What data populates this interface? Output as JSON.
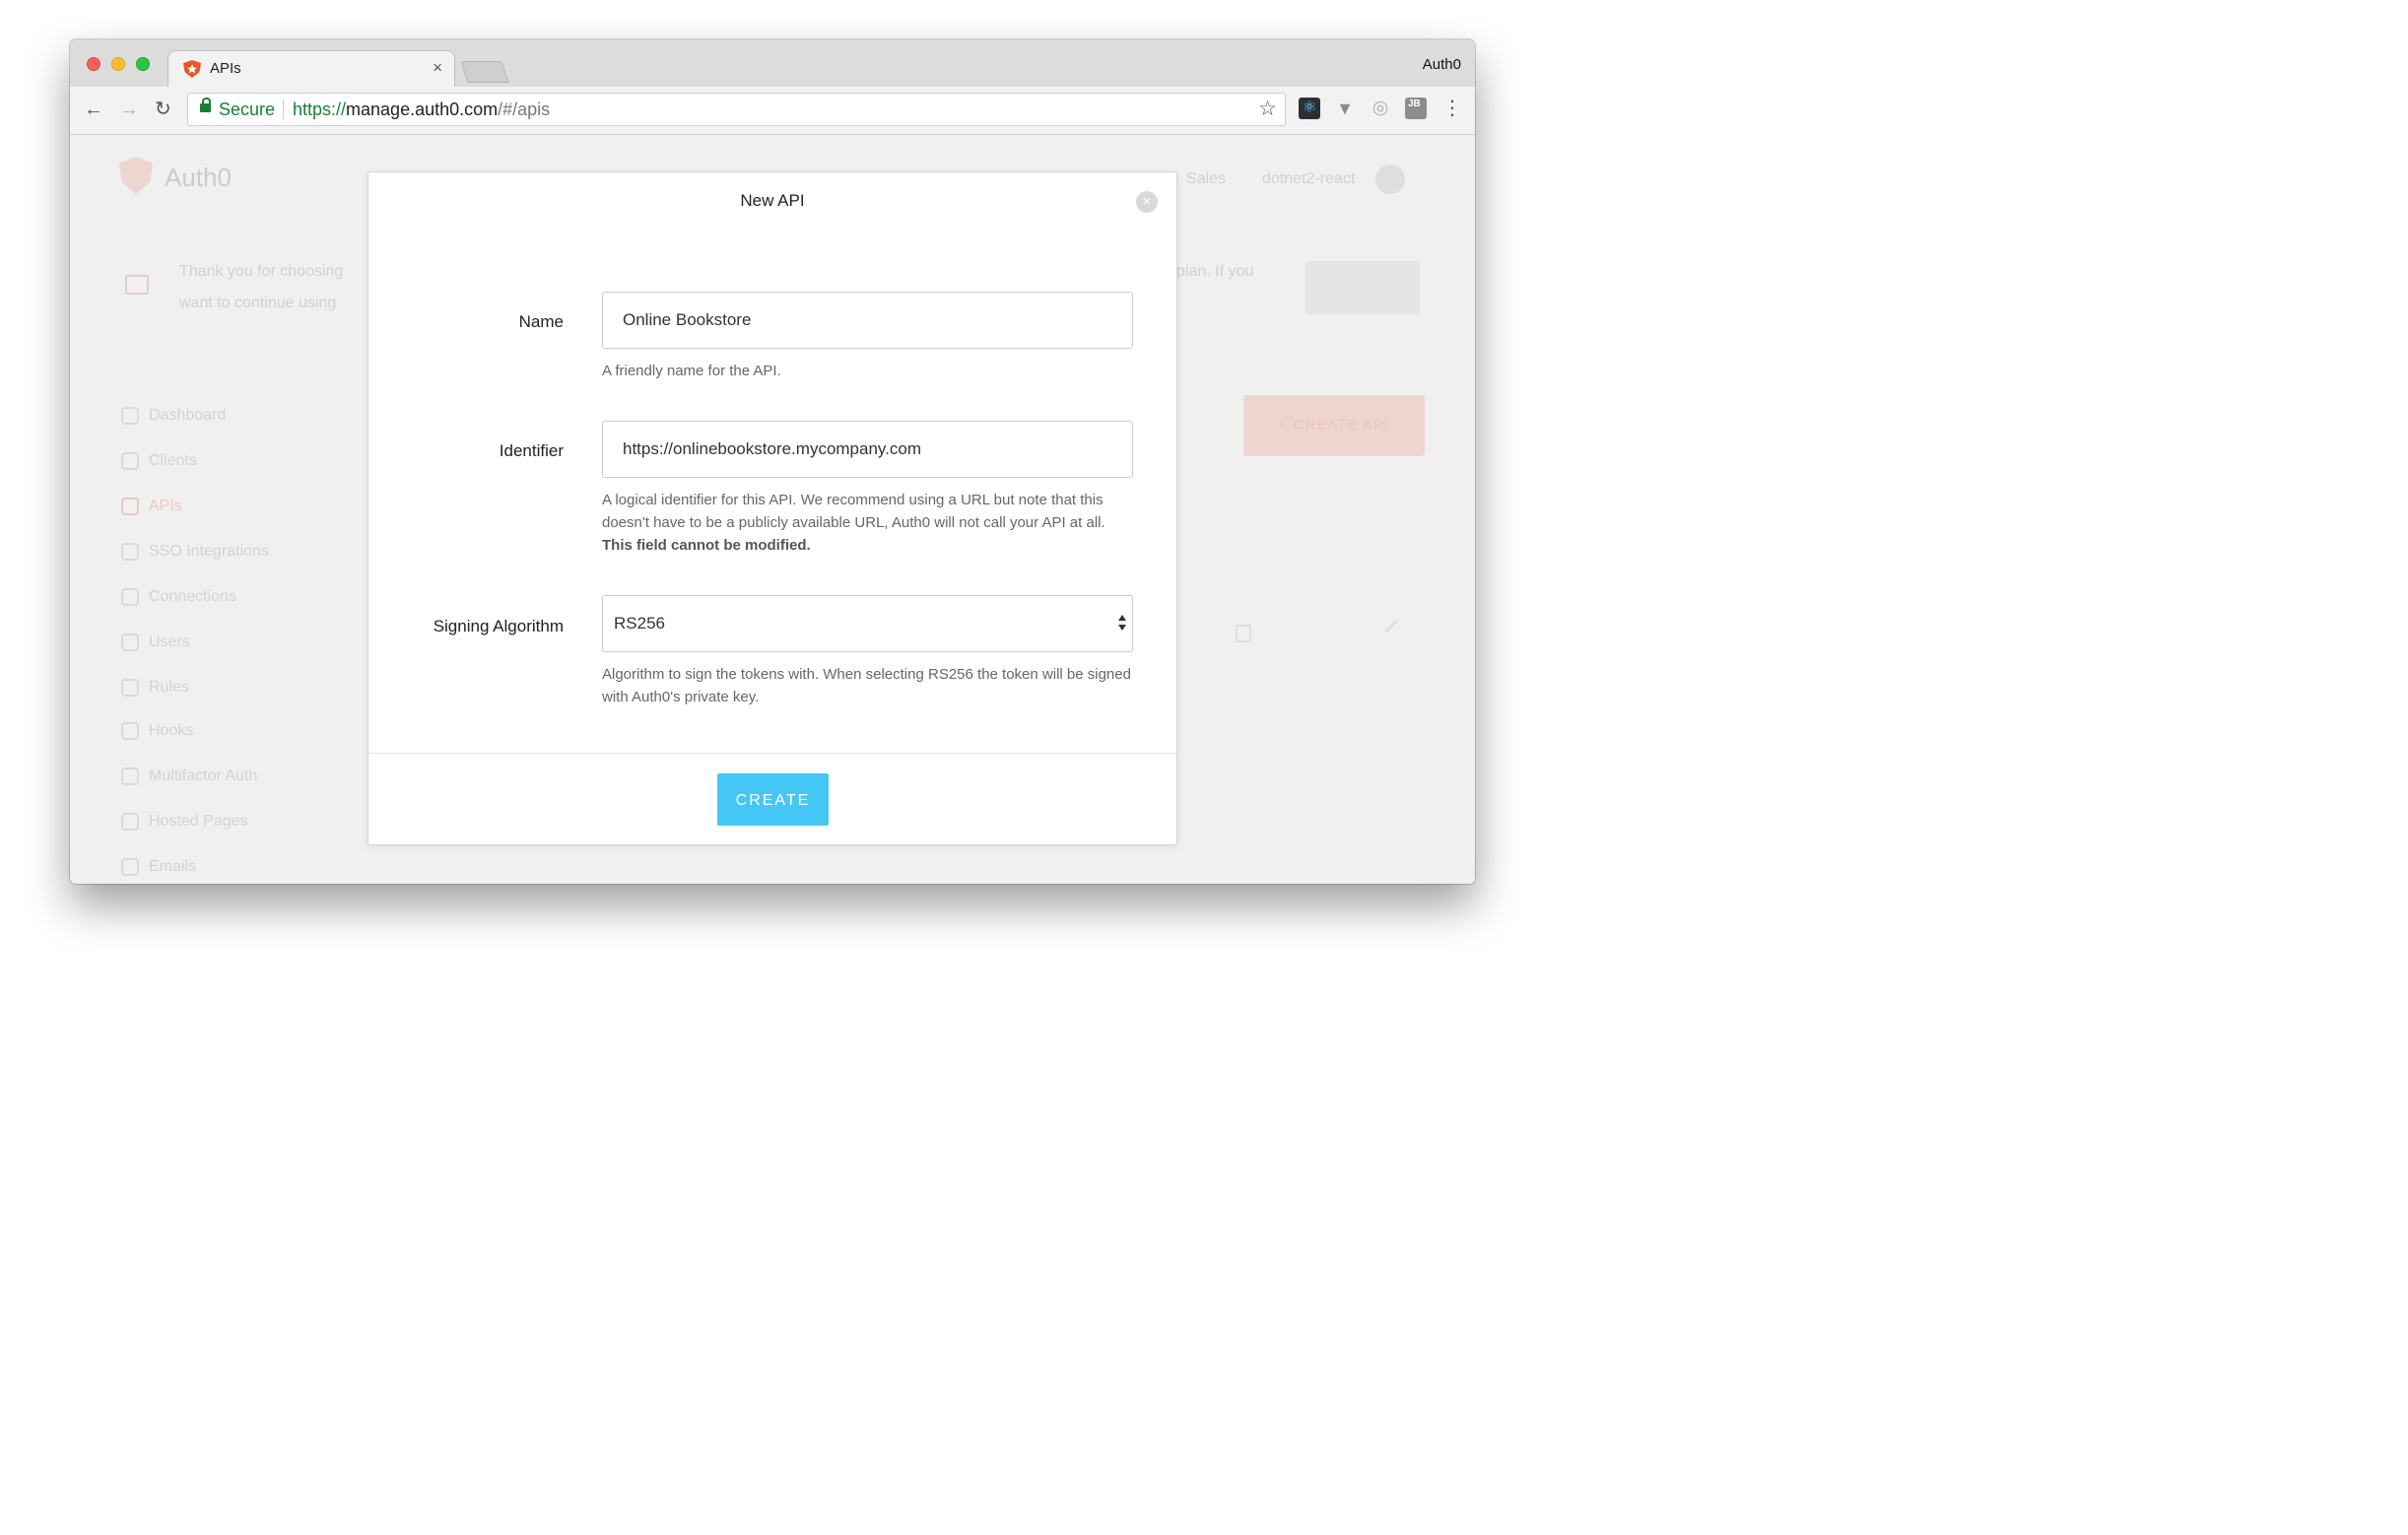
{
  "browser": {
    "tab_title": "APIs",
    "tab_close": "×",
    "profile_name": "Auth0",
    "secure_label": "Secure",
    "url_scheme": "https://",
    "url_host": "manage.auth0.com",
    "url_path": "/#/apis",
    "back_glyph": "←",
    "forward_glyph": "→",
    "reload_glyph": "↻",
    "star_glyph": "☆",
    "menu_glyph": "⋮",
    "extensions": {
      "react_glyph": "⚛",
      "vue_glyph": "▼",
      "gear_glyph": "◎",
      "jb_label": "JB"
    }
  },
  "background": {
    "logo_text": "Auth0",
    "header_link": "Sales",
    "tenant_name": "dotnet2-react",
    "notice_line1": "Thank you for choosing",
    "notice_line1_tail": "plan. If you",
    "notice_line2": "want to continue using",
    "create_api_label": "+ CREATE API",
    "sidebar": [
      {
        "label": "Dashboard",
        "active": false
      },
      {
        "label": "Clients",
        "active": false
      },
      {
        "label": "APIs",
        "active": true
      },
      {
        "label": "SSO Integrations",
        "active": false
      },
      {
        "label": "Connections",
        "active": false
      },
      {
        "label": "Users",
        "active": false
      },
      {
        "label": "Rules",
        "active": false
      },
      {
        "label": "Hooks",
        "active": false
      },
      {
        "label": "Multifactor Auth",
        "active": false
      },
      {
        "label": "Hosted Pages",
        "active": false
      },
      {
        "label": "Emails",
        "active": false
      }
    ]
  },
  "modal": {
    "title": "New API",
    "close_glyph": "×",
    "fields": {
      "name": {
        "label": "Name",
        "value": "Online Bookstore",
        "help": "A friendly name for the API."
      },
      "identifier": {
        "label": "Identifier",
        "value": "https://onlinebookstore.mycompany.com",
        "help": "A logical identifier for this API. We recommend using a URL but note that this doesn't have to be a publicly available URL, Auth0 will not call your API at all.",
        "help_bold": "This field cannot be modified."
      },
      "signing_algorithm": {
        "label": "Signing Algorithm",
        "value": "RS256",
        "help": "Algorithm to sign the tokens with. When selecting RS256 the token will be signed with Auth0's private key."
      }
    },
    "create_label": "CREATE"
  },
  "colors": {
    "accent": "#44c7f4",
    "brand": "#eb5424",
    "secure_green": "#188038"
  }
}
